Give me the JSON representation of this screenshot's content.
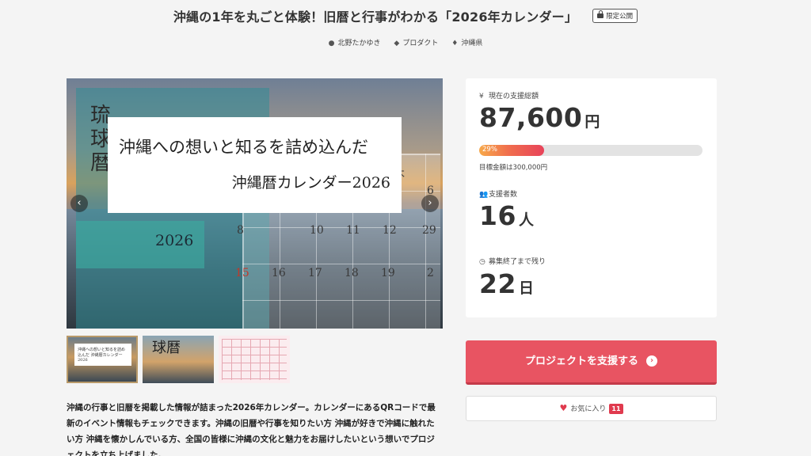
{
  "header": {
    "title": "沖縄の1年を丸ごと体験！旧暦と行事がわかる「2026年カレンダー」",
    "badge": "限定公開"
  },
  "meta": {
    "author": "北野たかゆき",
    "category": "プロダクト",
    "location": "沖縄県"
  },
  "hero": {
    "vertical_text": "琉球暦",
    "year": "2026",
    "overlay_line1": "沖縄への想いと知るを詰め込んだ",
    "overlay_line2": "沖縄暦カレンダー2026",
    "calendar_days": [
      "8",
      "10",
      "11",
      "12",
      "15",
      "16",
      "17",
      "18",
      "19",
      "木",
      "6",
      "2",
      "29"
    ],
    "prev_icon": "chevron-left-icon",
    "next_icon": "chevron-right-icon"
  },
  "thumbnails": {
    "thumb1_text": "沖縄への想いと知るを詰め込んだ 沖縄暦カレンダー2026",
    "thumb2_text": "球暦"
  },
  "description": "沖縄の行事と旧暦を掲載した情報が詰まった2026年カレンダー。カレンダーにあるQRコードで最新のイベント情報もチェックできます。沖縄の旧暦や行事を知りたい方 沖縄が好きで沖縄に触れたい方 沖縄を懐かしんでいる方、全国の皆様に沖縄の文化と魅力をお届けしたいという想いでプロジェクトを立ち上げました。",
  "stats": {
    "amount_label": "現在の支援総額",
    "amount_value": "87,600",
    "amount_unit": "円",
    "progress_label": "29%",
    "progress_fraction": 0.29,
    "goal_text": "目標金額は300,000円",
    "supporters_label": "支援者数",
    "supporters_value": "16",
    "supporters_unit": "人",
    "remaining_label": "募集終了まで残り",
    "remaining_value": "22",
    "remaining_unit": "日"
  },
  "actions": {
    "support_label": "プロジェクトを支援する",
    "favorite_label": "お気に入り",
    "favorite_count": "11"
  },
  "colors": {
    "accent": "#e85462",
    "heart": "#e03a4e"
  }
}
